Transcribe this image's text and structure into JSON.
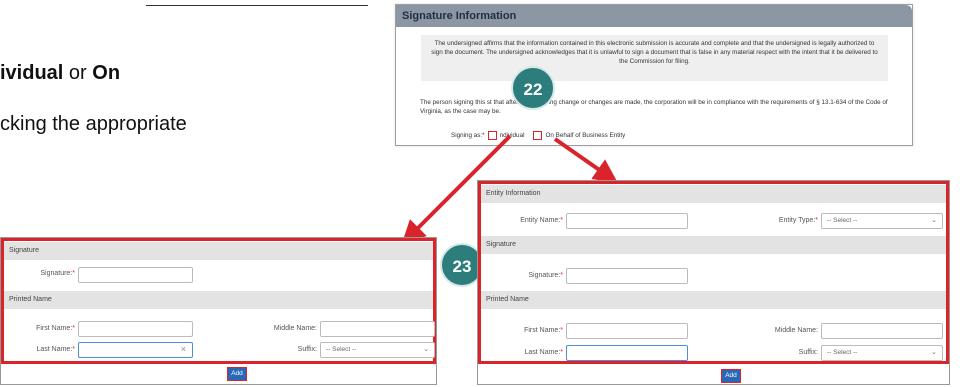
{
  "slide": {
    "line1_bold1": "ividual",
    "line1_or": " or ",
    "line1_bold2": "On",
    "line2": "cking the appropriate"
  },
  "signature_panel": {
    "header": "Signature Information",
    "affirmation": "The undersigned affirms that the information contained in this electronic submission is accurate and complete and that the undersigned is legally authorized to sign the document. The undersigned acknowledges that it is unlawful to sign a document that is false in any material respect with the intent that it be delivered to the Commission for filing.",
    "compliance": "The person signing this st                              that after the foregoing change or changes are made, the corporation will be in compliance with the requirements of § 13.1-634                of the Code of Virginia, as the case may be.",
    "signing_as_label": "Signing as:*",
    "option_individual": "ndividual",
    "option_entity": "On Behalf of Business Entity"
  },
  "badges": {
    "b22": "22",
    "b23": "23"
  },
  "individual_form": {
    "signature_section": "Signature",
    "signature_label": "Signature:",
    "printed_name_section": "Printed Name",
    "first_name_label": "First Name:",
    "middle_name_label": "Middle Name:",
    "last_name_label": "Last Name:",
    "suffix_label": "Suffix:",
    "suffix_value": "-- Select --",
    "add_button": "Add"
  },
  "entity_form": {
    "entity_section": "Entity Information",
    "entity_name_label": "Entity Name:",
    "entity_type_label": "Entity Type:",
    "entity_type_value": "-- Select --",
    "signature_section": "Signature",
    "signature_label": "Signature:",
    "printed_name_section": "Printed Name",
    "first_name_label": "First Name:",
    "middle_name_label": "Middle Name:",
    "last_name_label": "Last Name:",
    "suffix_label": "Suffix:",
    "suffix_value": "-- Select --",
    "add_button": "Add"
  },
  "required_mark": "*",
  "icons": {
    "clear": "×",
    "dropdown": "⌄"
  },
  "colors": {
    "accent_red": "#d9242b",
    "badge_teal": "#2e7d7d",
    "add_blue": "#2a68b7",
    "header_gray": "#8d96a3"
  }
}
